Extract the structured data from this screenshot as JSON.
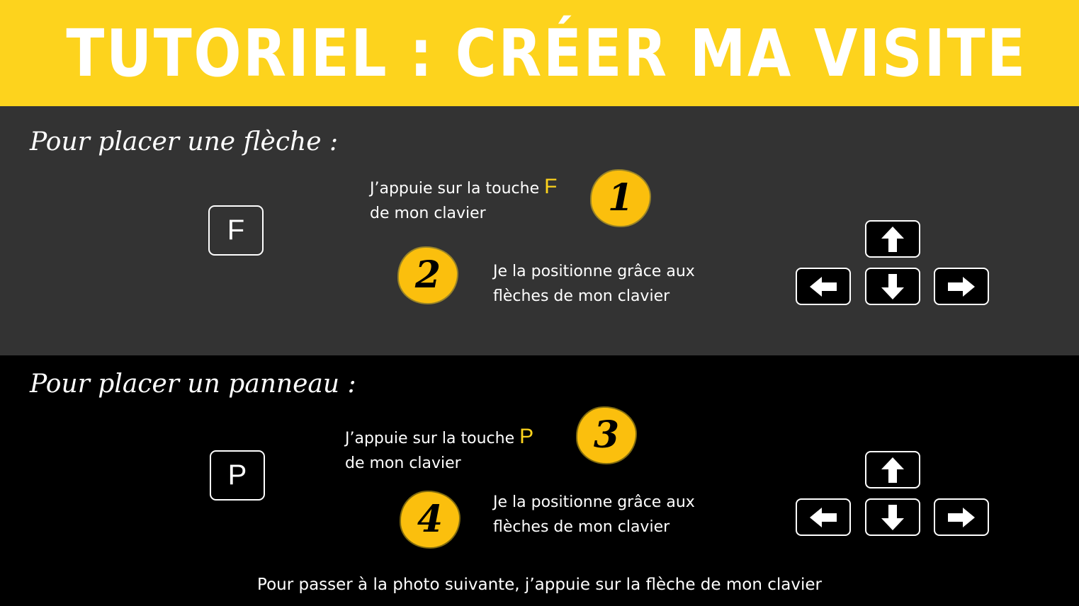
{
  "title": "TUTORIEL : CRÉER MA VISITE",
  "colors": {
    "accent": "#fdd31d",
    "panel_dark": "#333333",
    "panel_black": "#000000"
  },
  "section_arrow": {
    "heading": "Pour placer une flèche :",
    "key": "F",
    "step1": {
      "number": "1",
      "line1": "J’appuie sur la touche",
      "key": "F",
      "line2": "de mon clavier"
    },
    "step2": {
      "number": "2",
      "line1": "Je la positionne grâce aux",
      "line2": "flèches de mon clavier"
    },
    "arrow_keys": [
      "arrow-up-icon",
      "arrow-left-icon",
      "arrow-down-icon",
      "arrow-right-icon"
    ]
  },
  "section_panel": {
    "heading": "Pour placer un panneau :",
    "key": "P",
    "step3": {
      "number": "3",
      "line1": "J’appuie sur la touche",
      "key": "P",
      "line2": "de mon clavier"
    },
    "step4": {
      "number": "4",
      "line1": "Je la positionne grâce aux",
      "line2": "flèches de mon clavier"
    },
    "arrow_keys": [
      "arrow-up-icon",
      "arrow-left-icon",
      "arrow-down-icon",
      "arrow-right-icon"
    ]
  },
  "footer": "Pour passer à la photo suivante, j’appuie sur la flèche de mon clavier"
}
